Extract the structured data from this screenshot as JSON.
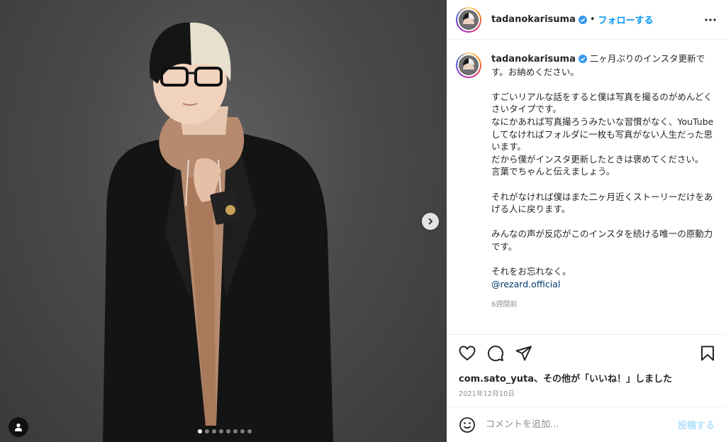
{
  "post": {
    "username": "tadanokarisuma",
    "follow_label": "フォローする",
    "separator": "•",
    "caption_first": "二ヶ月ぶりのインスタ更新です。お納めください。",
    "caption_body": "すごいリアルな話をすると僕は写真を撮るのがめんどくさいタイプです。\nなにかあれば写真撮ろうみたいな習慣がなく、YouTubeしてなければフォルダに一枚も写真がない人生だった思います。\nだから僕がインスタ更新したときは褒めてください。\n言葉でちゃんと伝えましょう。\n\nそれがなければ僕はまた二ヶ月近くストーリーだけをあげる人に戻ります。\n\nみんなの声が反応がこのインスタを続ける唯一の原動力です。\n\nそれをお忘れなく。",
    "mention": "@rezard.official",
    "time_ago": "6週間前",
    "likes_user": "com.sato_yuta",
    "likes_suffix": "、その他が「いいね！」しました",
    "date": "2021年12月10日"
  },
  "comment": {
    "placeholder": "コメントを追加...",
    "post_label": "投稿する"
  },
  "carousel": {
    "count": 8,
    "active": 0
  },
  "colors": {
    "accent": "#0095f6",
    "verified": "#3897f0",
    "post_disabled": "#b2dffc"
  }
}
